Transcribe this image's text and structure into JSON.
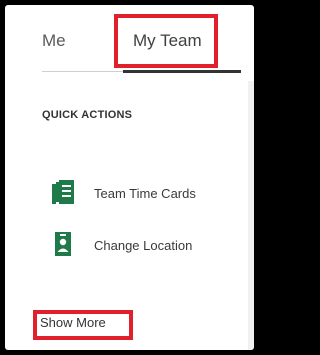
{
  "tabs": [
    {
      "label": "Me"
    },
    {
      "label": "My Team"
    }
  ],
  "active_tab": "My Team",
  "quick_actions": {
    "title": "QUICK ACTIONS",
    "items": [
      {
        "label": "Team Time Cards",
        "icon": "timecards-icon"
      },
      {
        "label": "Change Location",
        "icon": "location-badge-icon"
      }
    ]
  },
  "show_more": {
    "label": "Show More"
  },
  "colors": {
    "highlight": "#e0212b",
    "icon_green": "#1f7a4a"
  }
}
